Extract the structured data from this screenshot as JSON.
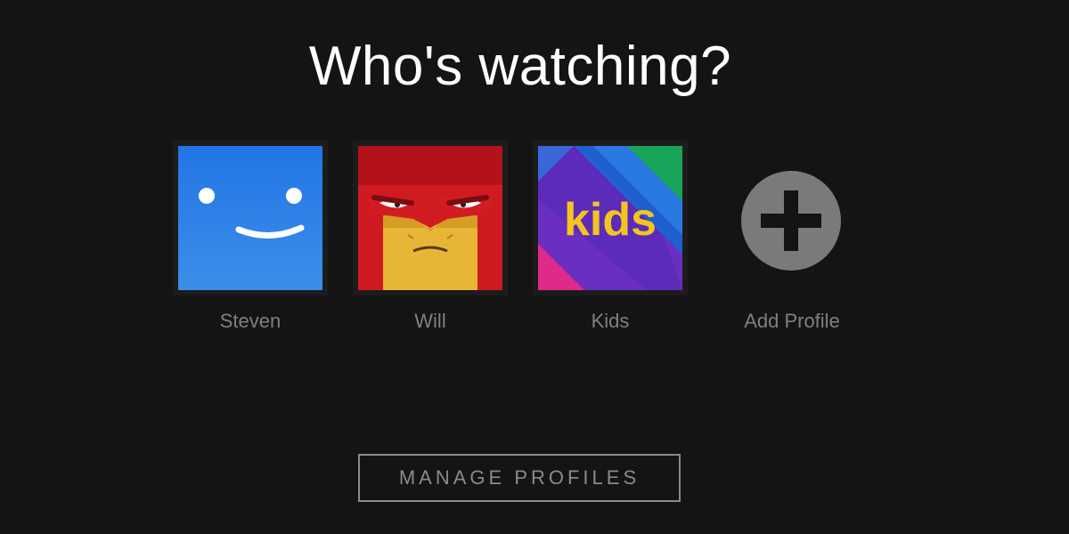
{
  "header": {
    "title": "Who's watching?"
  },
  "profiles": [
    {
      "name": "Steven",
      "avatar": "blue-smiley-avatar"
    },
    {
      "name": "Will",
      "avatar": "red-angry-face-avatar"
    },
    {
      "name": "Kids",
      "avatar": "kids-avatar",
      "avatar_text": "kids"
    }
  ],
  "add_profile": {
    "label": "Add Profile",
    "icon": "plus-icon"
  },
  "manage_button": {
    "label": "MANAGE PROFILES"
  },
  "colors": {
    "background": "#141414",
    "text": "#ffffff",
    "muted": "#808080",
    "steven_blue": "#2b7fe8",
    "will_red": "#d01a22",
    "will_yellow": "#e9b936",
    "kids_yellow": "#f3c51f",
    "add_gray": "#7a7a7a"
  }
}
